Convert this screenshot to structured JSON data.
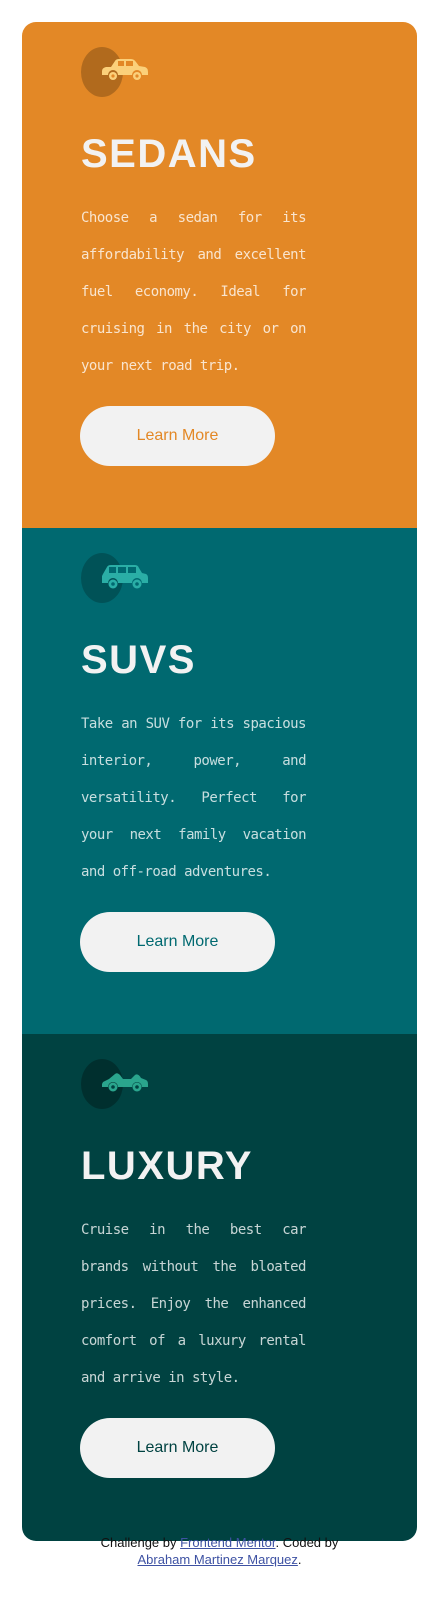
{
  "cards": [
    {
      "title": "SEDANS",
      "icon": "sedan-car-icon",
      "description": "Choose a sedan for its affordability and excellent fuel economy. Ideal for cruising in the city or on your next road trip.",
      "button_label": "Learn More",
      "color": "#e38826"
    },
    {
      "title": "SUVS",
      "icon": "suv-car-icon",
      "description": "Take an SUV for its spacious interior, power, and versatility. Perfect for your next family vacation and off-road adventures.",
      "button_label": "Learn More",
      "color": "#006970"
    },
    {
      "title": "LUXURY",
      "icon": "luxury-car-icon",
      "description": "Cruise in the best car brands without the bloated prices. Enjoy the enhanced comfort of a luxury rental and arrive in style.",
      "button_label": "Learn More",
      "color": "#004241"
    }
  ],
  "footer": {
    "prefix": "Challenge by ",
    "link1": "Frontend Mentor",
    "middle": ". Coded by ",
    "link2": "Abraham Martinez Marquez",
    "suffix": "."
  }
}
